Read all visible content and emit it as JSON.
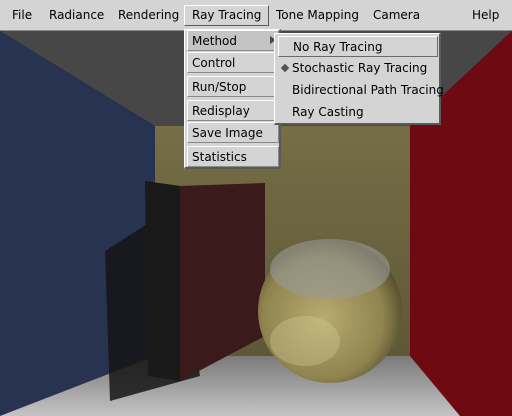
{
  "menubar": {
    "items": [
      "File",
      "Radiance",
      "Rendering",
      "Ray Tracing",
      "Tone Mapping",
      "Camera",
      "Help"
    ],
    "active": "Ray Tracing"
  },
  "ray_tracing_menu": {
    "items": [
      "Method",
      "Control",
      "Run/Stop",
      "Redisplay",
      "Save Image",
      "Statistics"
    ]
  },
  "method_submenu": {
    "items": [
      "No Ray Tracing",
      "Stochastic Ray Tracing",
      "Bidirectional Path Tracing",
      "Ray Casting"
    ],
    "selected": "Stochastic Ray Tracing"
  },
  "colors": {
    "menu_bg": "#d4d4d4",
    "left_wall": "#2a3550",
    "back_wall": "#6b6540",
    "right_wall": "#7a0a14",
    "ceiling": "#4a4a4a",
    "floor": "#8a8a8a",
    "sphere": "#a89b62"
  }
}
